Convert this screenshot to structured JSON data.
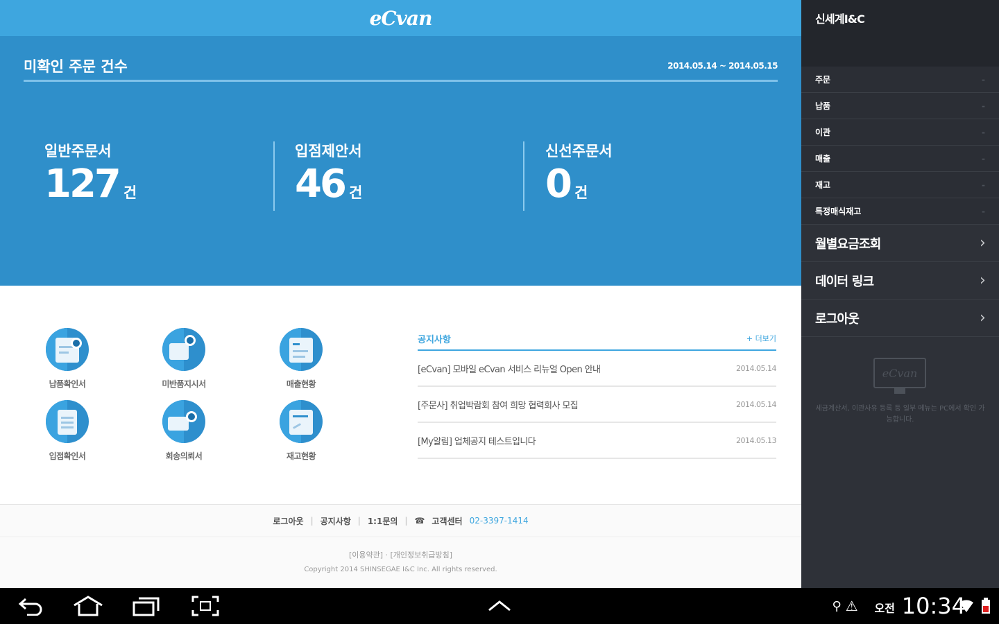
{
  "header": {
    "logo": "eCvan"
  },
  "summary": {
    "title": "미확인 주문 건수",
    "date_range": "2014.05.14 ~ 2014.05.15",
    "stats": [
      {
        "label": "일반주문서",
        "value": "127",
        "unit": "건"
      },
      {
        "label": "입점제안서",
        "value": "46",
        "unit": "건"
      },
      {
        "label": "신선주문서",
        "value": "0",
        "unit": "건"
      }
    ]
  },
  "quick_menu": [
    {
      "label": "납품확인서",
      "icon": "delivery-confirm-icon"
    },
    {
      "label": "미반품지시서",
      "icon": "return-order-icon"
    },
    {
      "label": "매출현황",
      "icon": "sales-status-icon"
    },
    {
      "label": "입점확인서",
      "icon": "entry-confirm-icon"
    },
    {
      "label": "회송의뢰서",
      "icon": "return-request-icon"
    },
    {
      "label": "재고현황",
      "icon": "inventory-status-icon"
    }
  ],
  "notice": {
    "title": "공지사항",
    "more": "+ 더보기",
    "items": [
      {
        "text": "[eCvan] 모바일 eCvan 서비스 리뉴얼 Open 안내",
        "date": "2014.05.14"
      },
      {
        "text": "[주문사] 취업박람회 참여 희망 협력회사 모집",
        "date": "2014.05.14"
      },
      {
        "text": "[My알림] 업체공지 테스트입니다",
        "date": "2014.05.13"
      }
    ]
  },
  "footer": {
    "links": [
      "로그아웃",
      "공지사항",
      "1:1문의"
    ],
    "call_center_label": "고객센터",
    "phone": "02-3397-1414",
    "terms": "[이용약관] · [개인정보취급방침]",
    "copyright": "Copyright 2014 SHINSEGAE I&C Inc. All rights reserved."
  },
  "sidebar": {
    "company": "신세계I&C",
    "small_items": [
      "주문",
      "납품",
      "이관",
      "매출",
      "재고",
      "특정매식재고"
    ],
    "big_items": [
      "월별요금조회",
      "데이터 링크",
      "로그아웃"
    ],
    "pc_logo": "eCvan",
    "pc_note": "세금계산서, 이관사유 등록 등 일부 메뉴는 PC에서 확인 가능합니다."
  },
  "system_bar": {
    "ampm": "오전",
    "time": "10:34"
  }
}
